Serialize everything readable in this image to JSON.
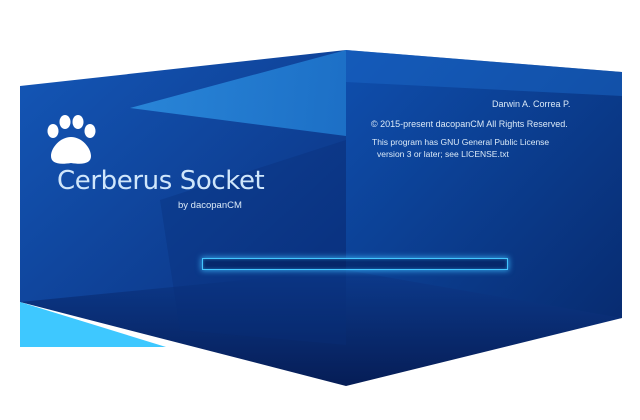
{
  "splash": {
    "title": "Cerberus Socket",
    "subtitle": "by dacopanCM",
    "author": "Darwin A. Correa P.",
    "copyright": "© 2015-present dacopanCM  All Rights Reserved.",
    "license_line1": "This program has GNU General Public License",
    "license_line2": "version 3 or later; see LICENSE.txt",
    "logo_icon": "paw-icon",
    "progress": 0
  },
  "colors": {
    "accent": "#3fc3ff",
    "panel_dark": "#0a2a72",
    "panel_mid": "#0f4aa8",
    "highlight": "#2c9ae8"
  }
}
